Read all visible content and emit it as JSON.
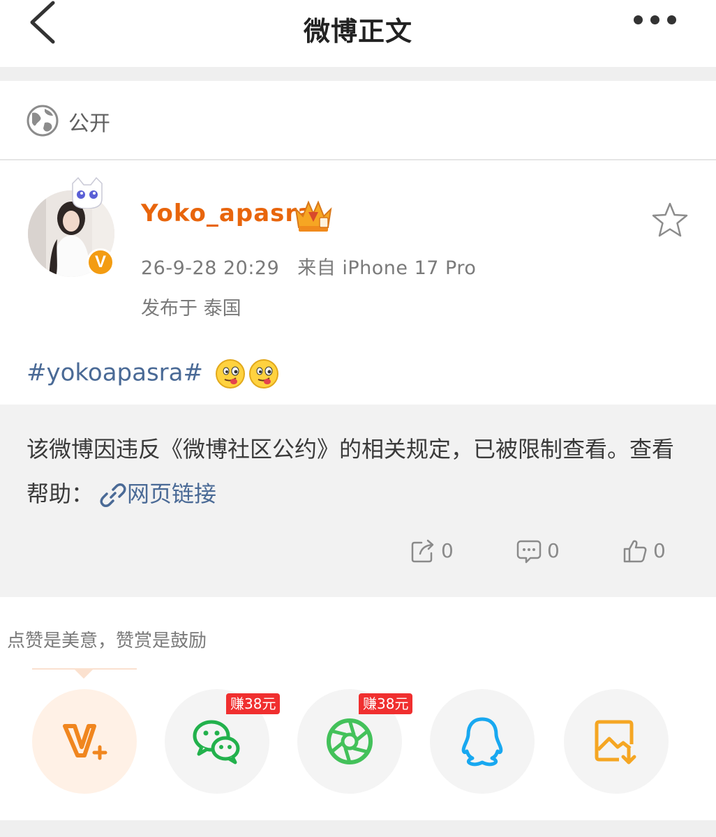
{
  "header": {
    "title": "微博正文",
    "back_icon": "chevron-left-icon",
    "more_icon": "more-dots-icon"
  },
  "visibility": {
    "icon": "globe-icon",
    "label": "公开"
  },
  "author": {
    "name": "Yoko_apasra",
    "verified": "V",
    "date": "26-9-28 20:29",
    "source": "来自 iPhone 17 Pro",
    "location": "发布于 泰国"
  },
  "post": {
    "hashtag": "#yokoapasra#",
    "emoji": [
      "tongue-face-emoji",
      "tongue-face-emoji"
    ],
    "notice": "该微博因违反《微博社区公约》的相关规定，已被限制查看。查看帮助：",
    "link_text": "网页链接"
  },
  "actions": {
    "repost": "0",
    "comment": "0",
    "like": "0"
  },
  "reward": {
    "prompt": "点赞是美意，赞赏是鼓励",
    "share_targets": [
      {
        "icon": "vplus-icon"
      },
      {
        "icon": "wechat-icon",
        "badge": "赚38元"
      },
      {
        "icon": "moments-icon",
        "badge": "赚38元"
      },
      {
        "icon": "qq-icon"
      },
      {
        "icon": "save-image-icon"
      }
    ]
  },
  "colors": {
    "accent": "#e8650c",
    "link": "#4a6a96",
    "badge": "#f02f2f",
    "notice_bg": "#f2f2f2"
  }
}
